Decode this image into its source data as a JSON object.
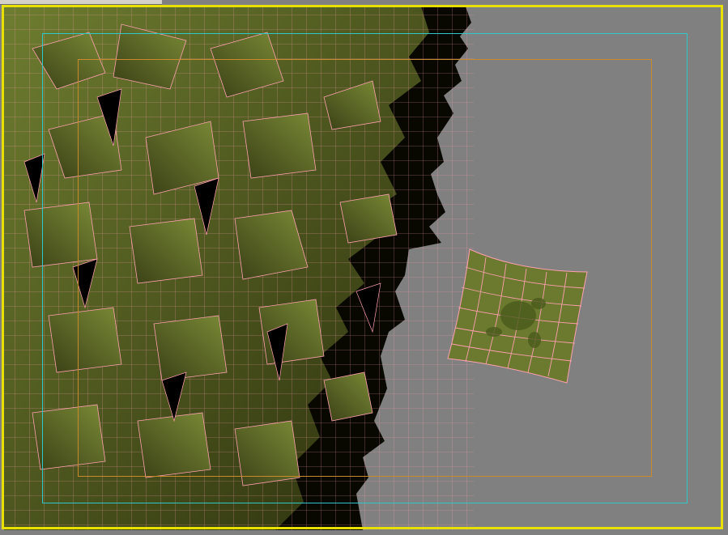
{
  "viewport": {
    "background_color": "#808080",
    "active_border_color": "#e8e000",
    "safe_frame_outer_color": "#2ec8c8",
    "safe_frame_inner_color": "#c88a2a",
    "wireframe_color": "#ff9fb0",
    "leaf_light_color": "#6b7a2e",
    "leaf_dark_color": "#1a1c08",
    "shadow_color": "#000000"
  },
  "scene": {
    "leaf_mass_icon": "foliage-cluster",
    "single_leaf_icon": "leaf-card-wireframe"
  }
}
